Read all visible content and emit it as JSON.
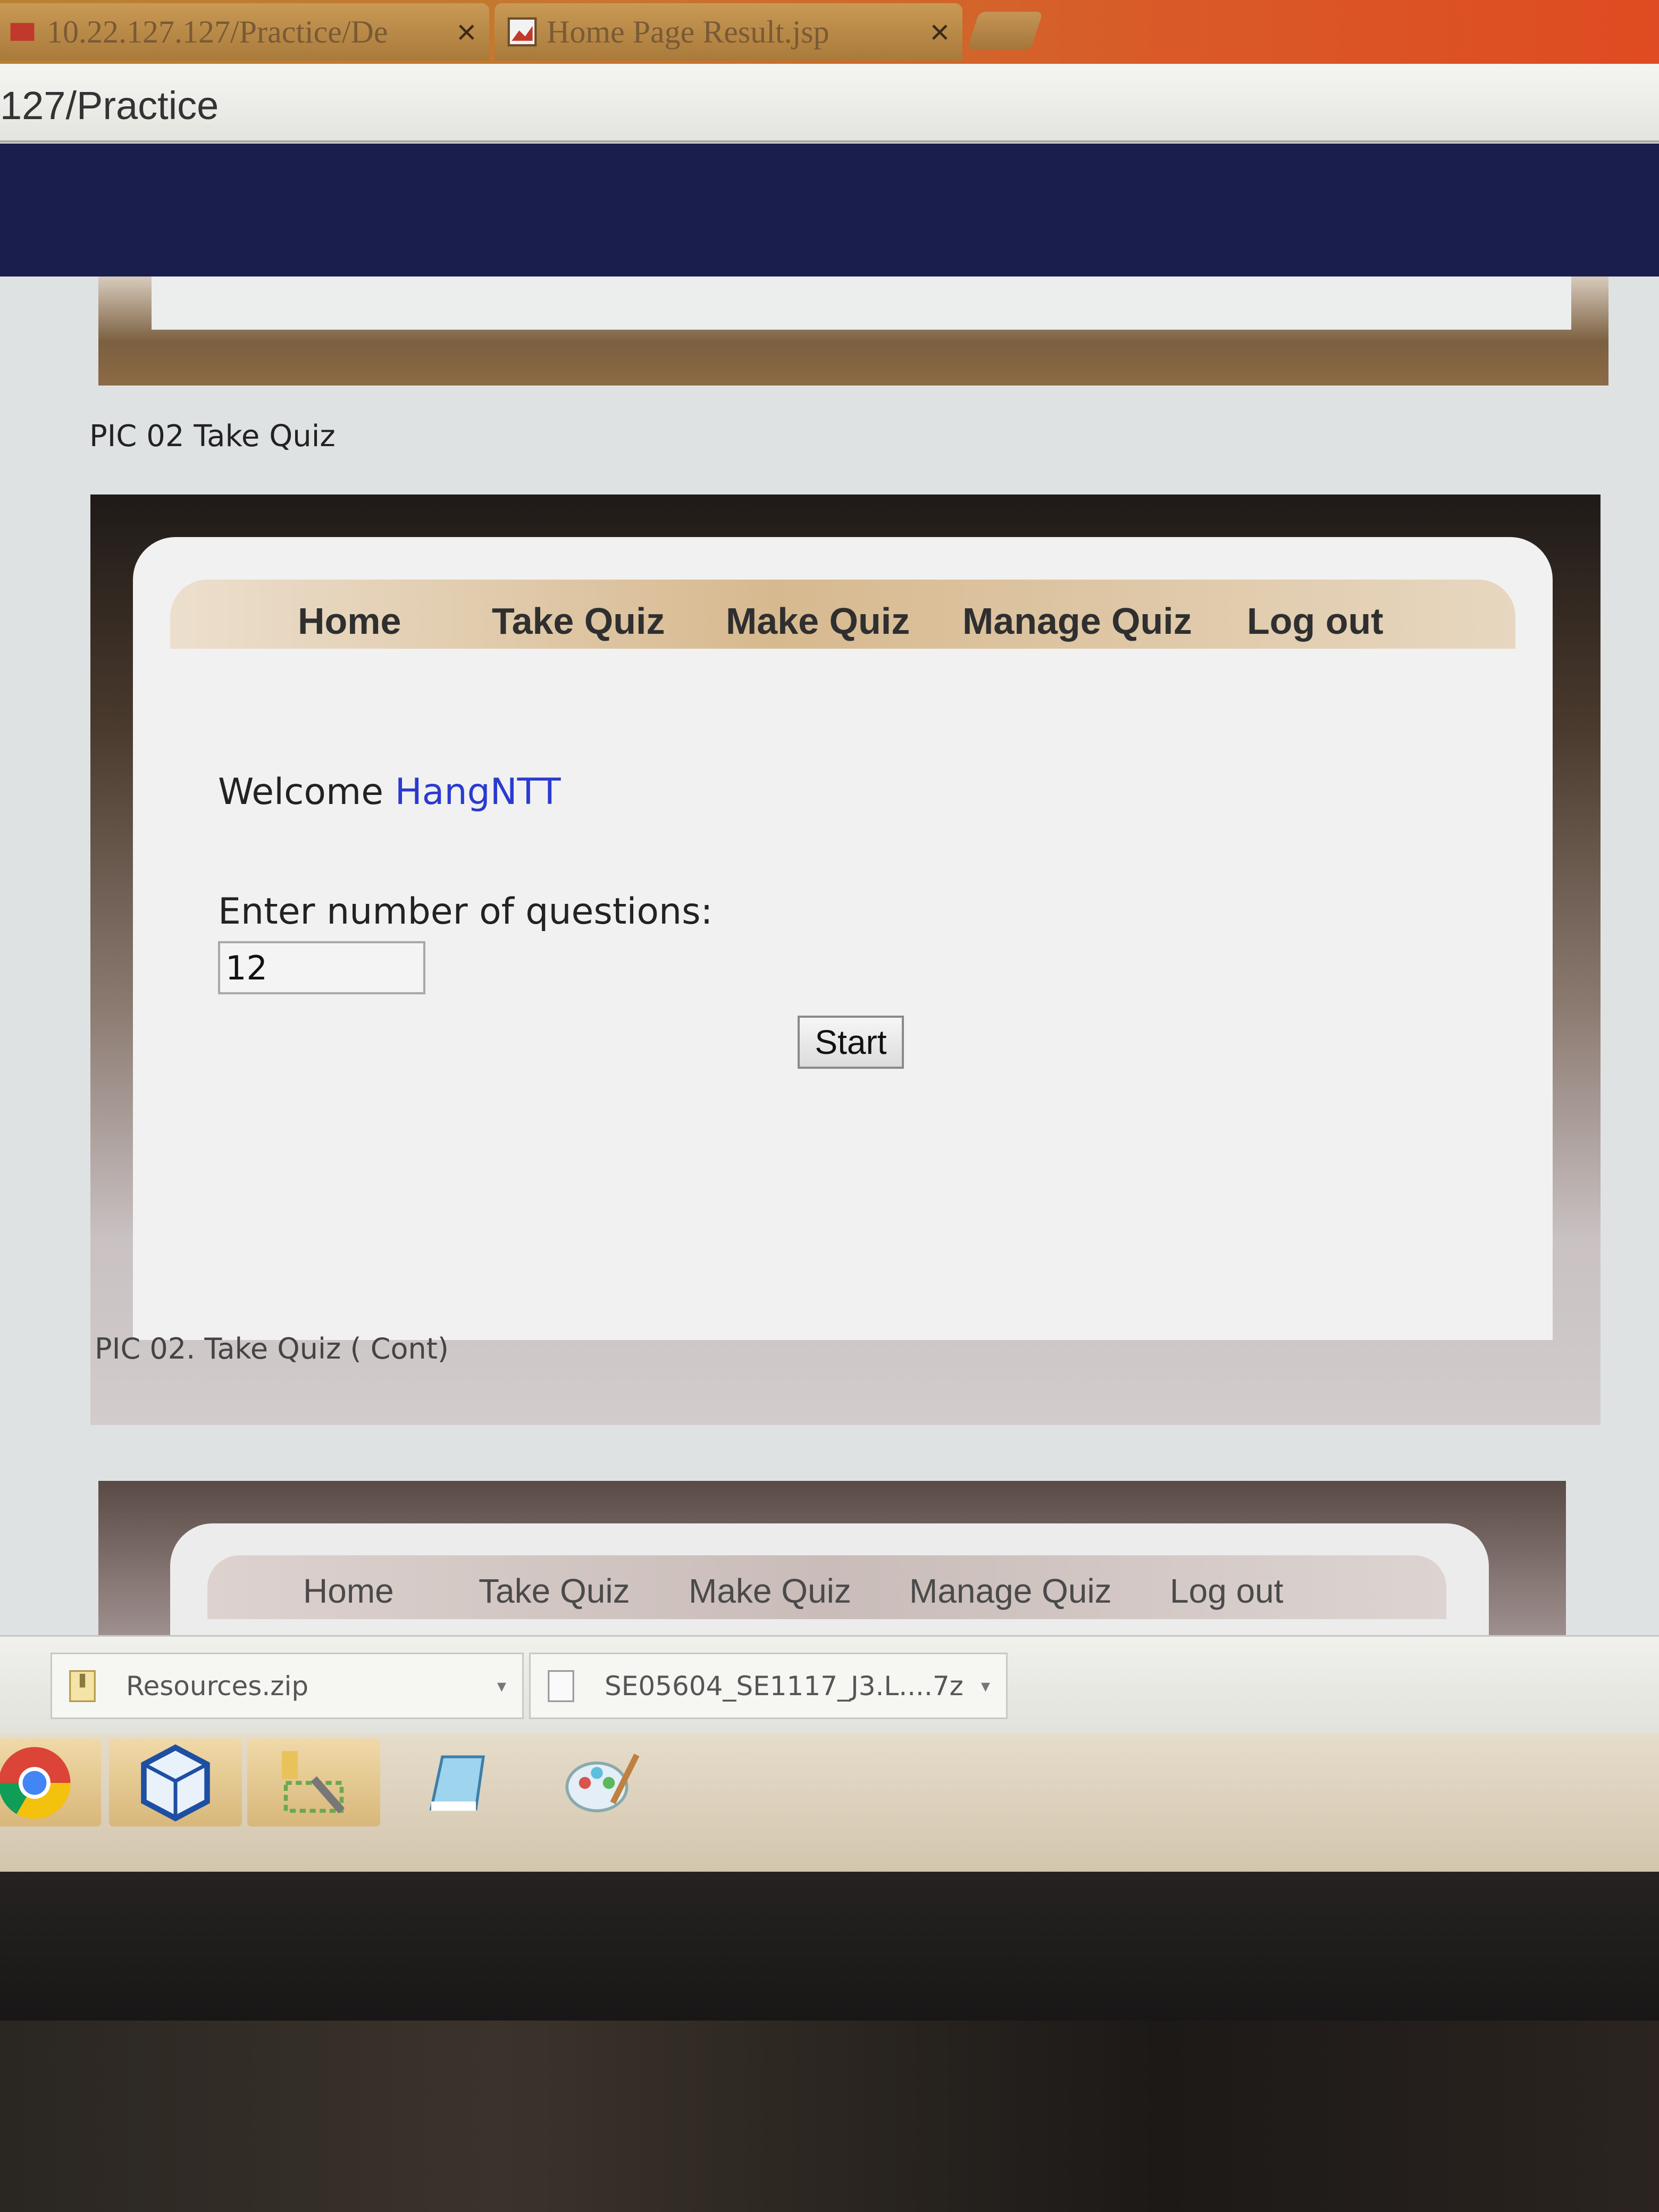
{
  "browser": {
    "tabs": [
      {
        "title": "10.22.127.127/Practice/De",
        "close": "×"
      },
      {
        "title": "Home Page Result.jsp",
        "close": "×"
      }
    ],
    "url": "127/Practice"
  },
  "captions": {
    "first": "PIC 02  Take Quiz",
    "second": "PIC 02. Take Quiz ( Cont)"
  },
  "nav": {
    "items": [
      "Home",
      "Take Quiz",
      "Make Quiz",
      "Manage Quiz",
      "Log out"
    ]
  },
  "quiz": {
    "welcome_prefix": "Welcome",
    "username": "HangNTT",
    "question_label": "Enter number of questions:",
    "question_value": "12",
    "start_label": "Start"
  },
  "downloads": [
    {
      "name": "Resources.zip",
      "icon": "zip-file-icon"
    },
    {
      "name": "SE05604_SE1117_J3.L....7z",
      "icon": "file-icon"
    }
  ],
  "taskbar": {
    "apps": [
      "chrome-icon",
      "virtualbox-icon",
      "tools-icon",
      "notepad-icon",
      "paint-icon"
    ]
  },
  "colors": {
    "navy_band": "#1a1e4d",
    "username": "#2a3ad0",
    "menu_tan": "#d7b98f"
  }
}
